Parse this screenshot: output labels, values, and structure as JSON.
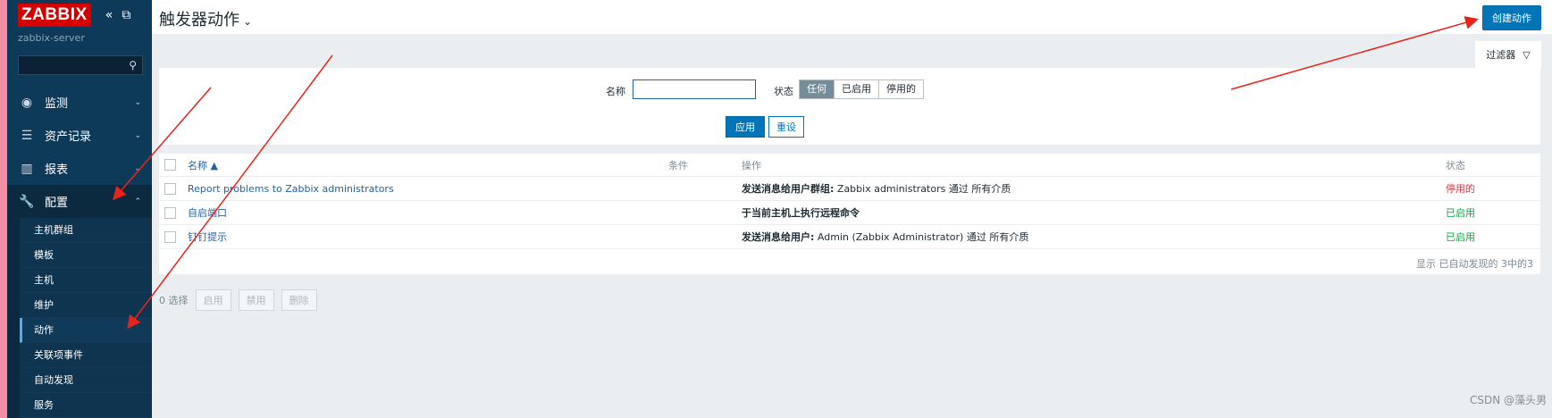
{
  "app": {
    "logo": "ZABBIX",
    "server": "zabbix-server"
  },
  "sidebar": {
    "search_placeholder": "",
    "items": [
      {
        "label": "监测",
        "icon": "eye-icon"
      },
      {
        "label": "资产记录",
        "icon": "list-icon"
      },
      {
        "label": "报表",
        "icon": "chart-icon"
      },
      {
        "label": "配置",
        "icon": "wrench-icon"
      }
    ],
    "submenu": [
      "主机群组",
      "模板",
      "主机",
      "维护",
      "动作",
      "关联项事件",
      "自动发现",
      "服务"
    ]
  },
  "header": {
    "title": "触发器动作",
    "create_label": "创建动作",
    "filter_label": "过滤器"
  },
  "filter": {
    "name_label": "名称",
    "name_value": "",
    "status_label": "状态",
    "status_options": [
      "任何",
      "已启用",
      "停用的"
    ],
    "apply_label": "应用",
    "reset_label": "重设"
  },
  "table": {
    "headers": {
      "name": "名称 ▲",
      "conditions": "条件",
      "operations": "操作",
      "status": "状态"
    },
    "rows": [
      {
        "name": "Report problems to Zabbix administrators",
        "op_bold": "发送消息给用户群组:",
        "op_text": " Zabbix administrators 通过 所有介质",
        "status": "停用的"
      },
      {
        "name": "自启端口",
        "op_bold": "于当前主机上执行远程命令",
        "op_text": "",
        "status": "已启用"
      },
      {
        "name": "钉钉提示",
        "op_bold": "发送消息给用户:",
        "op_text": " Admin (Zabbix Administrator) 通过 所有介质",
        "status": "已启用"
      }
    ],
    "footer": "显示 已自动发现的 3中的3"
  },
  "bulk": {
    "selected": "0 选择",
    "enable": "启用",
    "disable": "禁用",
    "delete": "删除"
  },
  "watermark": "CSDN @藻头男",
  "colors": {
    "sidebar": "#0e3a5a",
    "accent": "#0275b8",
    "logo": "#d40000",
    "annotation": "#e8231c"
  }
}
